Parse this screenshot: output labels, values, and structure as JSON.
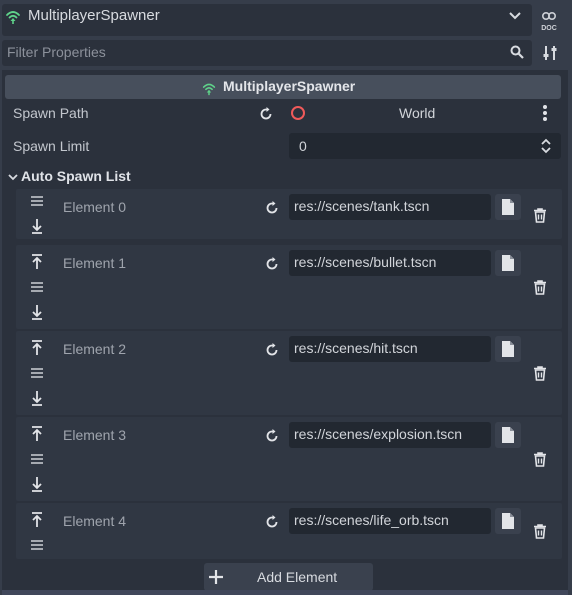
{
  "node_selector": {
    "selected": "MultiplayerSpawner",
    "icon": "multiplayer-signal-icon",
    "doc_icon": "doc-icon"
  },
  "filter": {
    "placeholder": "Filter Properties",
    "search_icon": "search-icon",
    "settings_icon": "settings-sliders-icon"
  },
  "section": {
    "title": "MultiplayerSpawner"
  },
  "properties": {
    "spawn_path": {
      "label": "Spawn Path",
      "value": "World"
    },
    "spawn_limit": {
      "label": "Spawn Limit",
      "value": "0"
    }
  },
  "auto_spawn_list": {
    "title": "Auto Spawn List",
    "elements": [
      {
        "label": "Element 0",
        "path": "res://scenes/tank.tscn"
      },
      {
        "label": "Element 1",
        "path": "res://scenes/bullet.tscn"
      },
      {
        "label": "Element 2",
        "path": "res://scenes/hit.tscn"
      },
      {
        "label": "Element 3",
        "path": "res://scenes/explosion.tscn"
      },
      {
        "label": "Element 4",
        "path": "res://scenes/life_orb.tscn"
      }
    ],
    "add_label": "Add Element"
  },
  "colors": {
    "background": "#363d4a",
    "panel": "#2b313c",
    "accent_green": "#5fd38a",
    "path_ring": "#f05a5a"
  }
}
